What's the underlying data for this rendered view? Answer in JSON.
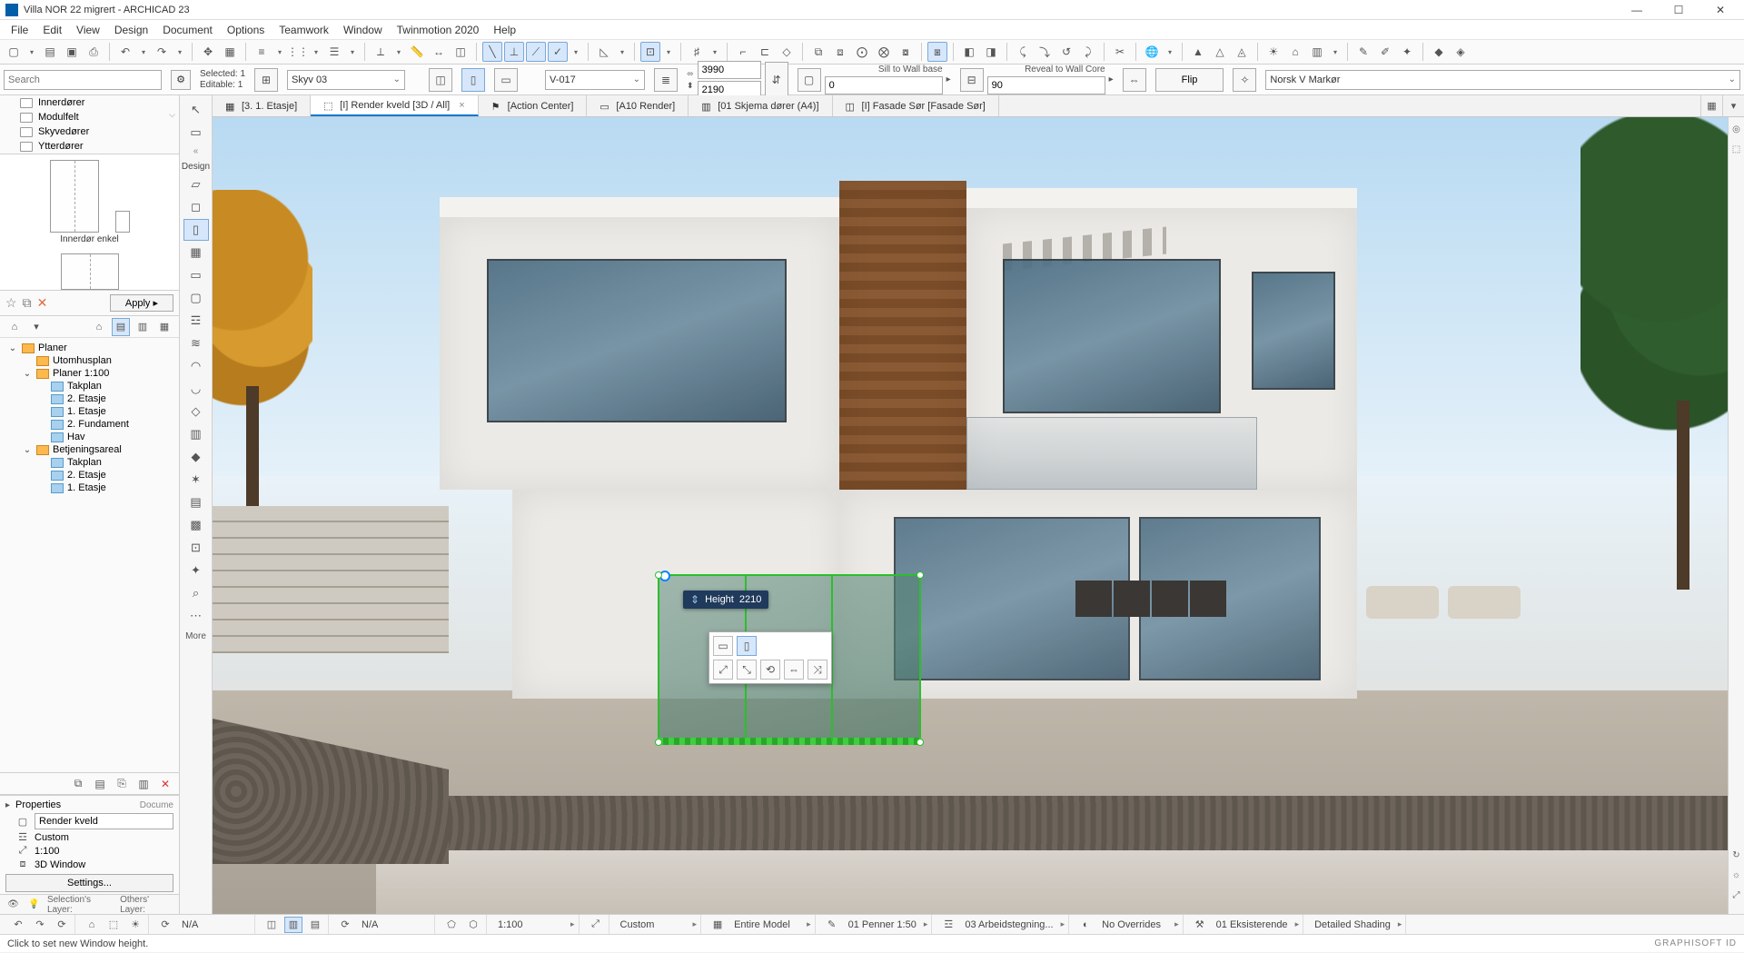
{
  "app": {
    "title": "Villa NOR 22 migrert - ARCHICAD 23"
  },
  "menus": [
    "File",
    "Edit",
    "View",
    "Design",
    "Document",
    "Options",
    "Teamwork",
    "Window",
    "Twinmotion 2020",
    "Help"
  ],
  "search": {
    "placeholder": "Search"
  },
  "library_folders": [
    "Innerdører",
    "Modulfelt",
    "Skyvedører",
    "Ytterdører"
  ],
  "preview": {
    "label": "Innerdør enkel"
  },
  "favorites": {
    "apply": "Apply"
  },
  "nav_tree": {
    "root": "Planer",
    "items": [
      {
        "name": "Utomhusplan",
        "children": []
      },
      {
        "name": "Planer 1:100",
        "expanded": true,
        "children": [
          {
            "name": "Takplan"
          },
          {
            "name": "2. Etasje"
          },
          {
            "name": "1. Etasje"
          },
          {
            "name": "2. Fundament"
          },
          {
            "name": "Hav"
          }
        ]
      },
      {
        "name": "Betjeningsareal",
        "expanded": true,
        "children": [
          {
            "name": "Takplan"
          },
          {
            "name": "2. Etasje"
          },
          {
            "name": "1. Etasje"
          }
        ]
      }
    ]
  },
  "properties": {
    "header": "Properties",
    "name": "Render kveld",
    "custom": "Custom",
    "scale": "1:100",
    "view": "3D Window",
    "settings": "Settings...",
    "docume_tab": "Docume"
  },
  "selection_info": {
    "selected": "Selected: 1",
    "editable": "Editable: 1"
  },
  "element_combo": "Skyv 03",
  "layer_combo": "V-017",
  "dims": {
    "width": "3990",
    "height": "2190"
  },
  "sill": {
    "label": "Sill to Wall base",
    "value": "0"
  },
  "reveal": {
    "label": "Reveal to Wall Core",
    "value": "90"
  },
  "flip": "Flip",
  "marker": "Norsk V Markør",
  "design_label": "Design",
  "more_label": "More",
  "tabs": [
    {
      "label": "[3. 1. Etasje]",
      "icon": "plan"
    },
    {
      "label": "[I] Render kveld [3D / All]",
      "icon": "3d",
      "active": true,
      "closable": true
    },
    {
      "label": "[Action Center]",
      "icon": "action"
    },
    {
      "label": "[A10 Render]",
      "icon": "layout"
    },
    {
      "label": "[01 Skjema dører (A4)]",
      "icon": "layout"
    },
    {
      "label": "[I] Fasade Sør [Fasade Sør]",
      "icon": "elev"
    }
  ],
  "tracker": {
    "label": "Height",
    "value": "2210"
  },
  "quickbar": {
    "na1": "N/A",
    "na2": "N/A",
    "scale": "1:100",
    "custom": "Custom",
    "model": "Entire Model",
    "penset": "01 Penner 1:50",
    "layers": "03 Arbeidstegning...",
    "overrides": "No Overrides",
    "reno": "01 Eksisterende",
    "shading": "Detailed Shading"
  },
  "layer_picker": {
    "sel": "Selection's Layer:",
    "oth": "Others' Layer:"
  },
  "status": "Click to set new Window height.",
  "brand": "GRAPHISOFT ID"
}
